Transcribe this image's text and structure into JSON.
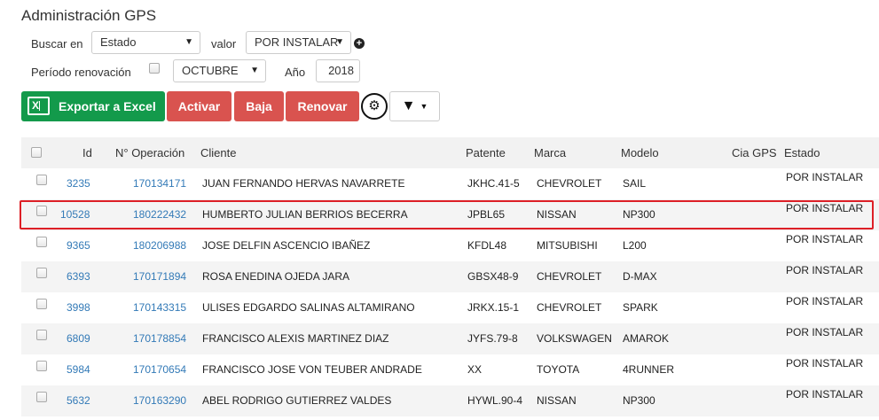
{
  "title": "Administración GPS",
  "search": {
    "buscar_label": "Buscar en",
    "buscar_value": "Estado",
    "valor_label": "valor",
    "valor_value": "POR INSTALAR",
    "periodo_label": "Período renovación",
    "mes_value": "OCTUBRE",
    "anio_label": "Año",
    "anio_value": "2018"
  },
  "toolbar": {
    "excel_label": "Exportar a Excel",
    "activar_label": "Activar",
    "baja_label": "Baja",
    "renovar_label": "Renovar"
  },
  "table": {
    "headers": [
      "Id",
      "N° Operación",
      "Cliente",
      "Patente",
      "Marca",
      "Modelo",
      "Cia GPS",
      "Estado"
    ],
    "rows": [
      {
        "id": "3235",
        "operacion": "170134171",
        "cliente": "JUAN FERNANDO HERVAS NAVARRETE",
        "patente": "JKHC.41-5",
        "marca": "CHEVROLET",
        "modelo": "SAIL",
        "cia": "",
        "estado": "POR INSTALAR"
      },
      {
        "id": "10528",
        "operacion": "180222432",
        "cliente": "HUMBERTO JULIAN BERRIOS BECERRA",
        "patente": "JPBL65",
        "marca": "NISSAN",
        "modelo": "NP300",
        "cia": "",
        "estado": "POR INSTALAR"
      },
      {
        "id": "9365",
        "operacion": "180206988",
        "cliente": "JOSE DELFIN ASCENCIO IBAÑEZ",
        "patente": "KFDL48",
        "marca": "MITSUBISHI",
        "modelo": "L200",
        "cia": "",
        "estado": "POR INSTALAR"
      },
      {
        "id": "6393",
        "operacion": "170171894",
        "cliente": "ROSA ENEDINA OJEDA JARA",
        "patente": "GBSX48-9",
        "marca": "CHEVROLET",
        "modelo": "D-MAX",
        "cia": "",
        "estado": "POR INSTALAR"
      },
      {
        "id": "3998",
        "operacion": "170143315",
        "cliente": "ULISES EDGARDO SALINAS ALTAMIRANO",
        "patente": "JRKX.15-1",
        "marca": "CHEVROLET",
        "modelo": "SPARK",
        "cia": "",
        "estado": "POR INSTALAR"
      },
      {
        "id": "6809",
        "operacion": "170178854",
        "cliente": "FRANCISCO ALEXIS MARTINEZ DIAZ",
        "patente": "JYFS.79-8",
        "marca": "VOLKSWAGEN",
        "modelo": "AMAROK",
        "cia": "",
        "estado": "POR INSTALAR"
      },
      {
        "id": "5984",
        "operacion": "170170654",
        "cliente": "FRANCISCO JOSE VON TEUBER ANDRADE",
        "patente": "XX",
        "marca": "TOYOTA",
        "modelo": "4RUNNER",
        "cia": "",
        "estado": "POR INSTALAR"
      },
      {
        "id": "5632",
        "operacion": "170163290",
        "cliente": "ABEL RODRIGO GUTIERREZ VALDES",
        "patente": "HYWL.90-4",
        "marca": "NISSAN",
        "modelo": "NP300",
        "cia": "",
        "estado": "POR INSTALAR"
      }
    ]
  },
  "colors": {
    "excel": "#139a4b",
    "danger": "#d9534f",
    "link": "#337ab7",
    "highlight": "#dd1f26"
  },
  "icons": [
    "excel-icon",
    "add-circle-icon",
    "report-settings-icon",
    "filter-icon",
    "caret-down-icon"
  ]
}
